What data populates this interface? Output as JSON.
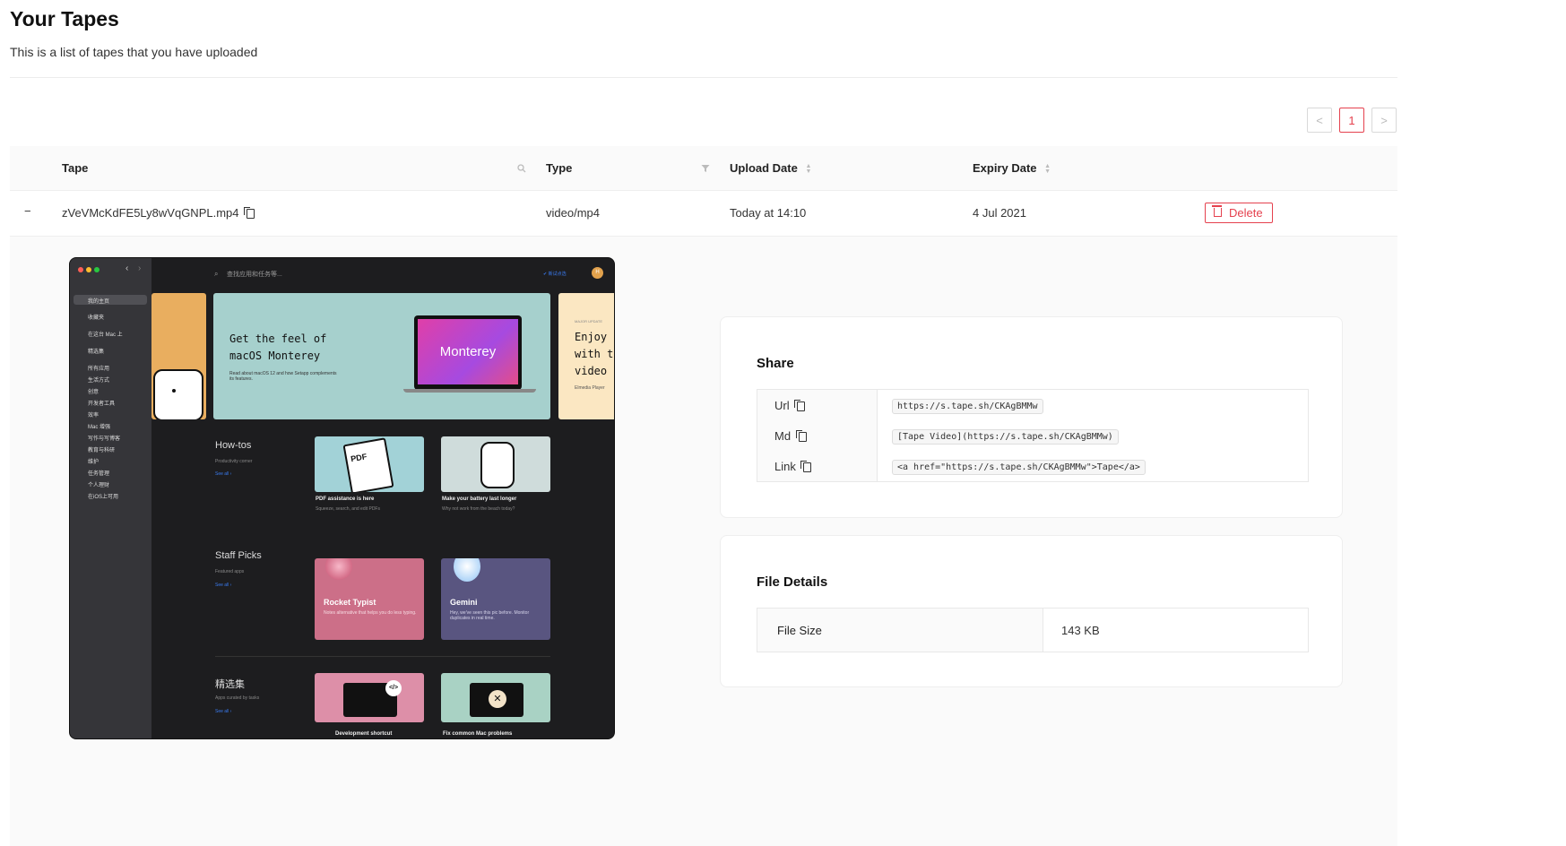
{
  "header": {
    "title": "Your Tapes",
    "subtitle": "This is a list of tapes that you have uploaded"
  },
  "pagination": {
    "prev": "<",
    "current": "1",
    "next": ">"
  },
  "table": {
    "columns": {
      "tape": "Tape",
      "type": "Type",
      "upload_date": "Upload Date",
      "expiry_date": "Expiry Date"
    },
    "row": {
      "collapse": "−",
      "name": "zVeVMcKdFE5Ly8wVqGNPL.mp4",
      "type": "video/mp4",
      "upload_date": "Today at 14:10",
      "expiry_date": "4 Jul 2021",
      "delete_label": "Delete"
    }
  },
  "preview": {
    "search_placeholder": "查找应用和任务等...",
    "top_right": "✔ 新试点选",
    "avatar": "H",
    "sidebar": [
      "我的主页",
      "收藏夹",
      "在这台 Mac 上",
      "精选集",
      "所有应用",
      "生活方式",
      "创意",
      "开发者工具",
      "效率",
      "Mac 增强",
      "写作与写博客",
      "教育与科研",
      "维护",
      "任务管理",
      "个人理财",
      "在iOS上可用"
    ],
    "hero": {
      "title_line1": "Get the feel of",
      "title_line2": "macOS Monterey",
      "desc": "Read about macOS 12 and how Setapp complements its features.",
      "screen": "Monterey",
      "side_tag": "MAJOR UPDATE",
      "side_line1": "Enjoy",
      "side_line2": "with t",
      "side_line3": "video",
      "side_foot": "Elmedia Player"
    },
    "sections": [
      {
        "title": "How-tos",
        "sub": "Productivity corner",
        "see": "See all ›",
        "cards": [
          {
            "title": "PDF assistance is here",
            "sub": "Squeeze, search, and edit PDFs",
            "icon": "PDF"
          },
          {
            "title": "Make your battery last longer",
            "sub": "Why not work from the beach today?"
          }
        ]
      },
      {
        "title": "Staff Picks",
        "sub": "Featured apps",
        "see": "See all ›",
        "cards": [
          {
            "title": "Rocket Typist",
            "sub": "Notes alternative that helps you do less typing."
          },
          {
            "title": "Gemini",
            "sub": "Hey, we've seen this pic before. Monitor duplicates in real time."
          }
        ]
      },
      {
        "title": "精选集",
        "sub": "Apps curated by tasks",
        "see": "See all ›",
        "cards": [
          {
            "title": "Development shortcut",
            "icon": "</>"
          },
          {
            "title": "Fix common Mac problems"
          }
        ]
      }
    ]
  },
  "share": {
    "title": "Share",
    "rows": [
      {
        "label": "Url",
        "value": "https://s.tape.sh/CKAgBMMw"
      },
      {
        "label": "Md",
        "value": "[Tape Video](https://s.tape.sh/CKAgBMMw)"
      },
      {
        "label": "Link",
        "value": "<a href=\"https://s.tape.sh/CKAgBMMw\">Tape</a>"
      }
    ]
  },
  "file_details": {
    "title": "File Details",
    "label": "File Size",
    "value": "143 KB"
  },
  "colors": {
    "accent": "#e5414e",
    "link": "#3a7bf0"
  },
  "icons": [
    "search-icon",
    "filter-icon",
    "sort-icon",
    "copy-icon",
    "trash-icon"
  ]
}
